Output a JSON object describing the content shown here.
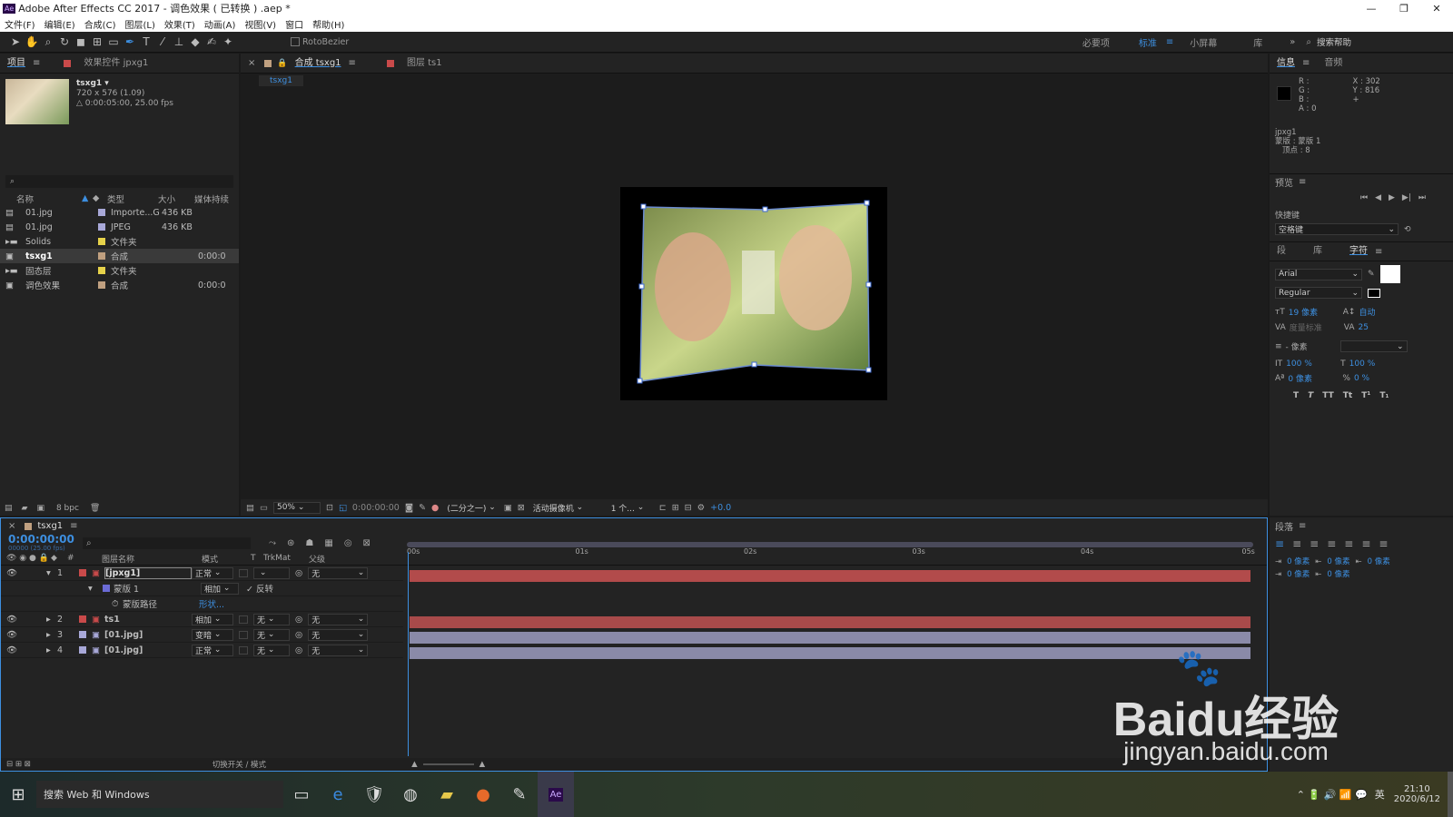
{
  "title_bar": {
    "app_title": "Adobe After Effects CC 2017 - 调色效果 ( 已转换 ) .aep *",
    "logo": "Ae"
  },
  "menu": [
    "文件(F)",
    "编辑(E)",
    "合成(C)",
    "图层(L)",
    "效果(T)",
    "动画(A)",
    "视图(V)",
    "窗口",
    "帮助(H)"
  ],
  "toolbar": {
    "rotobezier": "RotoBezier",
    "workspaces": [
      "必要项",
      "标准",
      "小屏幕",
      "库"
    ],
    "search_placeholder": "搜索帮助"
  },
  "project_panel": {
    "tabs": [
      "项目",
      "效果控件 jpxg1"
    ],
    "item_name": "tsxg1 ▾",
    "item_dims": "720 x 576 (1.09)",
    "item_duration": "△ 0:00:05:00, 25.00 fps",
    "columns": [
      "名称",
      "类型",
      "大小",
      "媒体持续"
    ],
    "items": [
      {
        "name": "01.jpg",
        "type": "Importe...G",
        "size": "436 KB",
        "dur": "",
        "color": "#a8a8d8",
        "kind": "file"
      },
      {
        "name": "01.jpg",
        "type": "JPEG",
        "size": "436 KB",
        "dur": "",
        "color": "#a8a8d8",
        "kind": "file"
      },
      {
        "name": "Solids",
        "type": "文件夹",
        "size": "",
        "dur": "",
        "color": "#e6d24a",
        "kind": "folder"
      },
      {
        "name": "tsxg1",
        "type": "合成",
        "size": "",
        "dur": "0:00:0",
        "color": "#c0a080",
        "kind": "comp",
        "selected": true
      },
      {
        "name": "固态层",
        "type": "文件夹",
        "size": "",
        "dur": "",
        "color": "#e6d24a",
        "kind": "folder"
      },
      {
        "name": "调色效果",
        "type": "合成",
        "size": "",
        "dur": "0:00:0",
        "color": "#c0a080",
        "kind": "comp"
      }
    ],
    "bpc": "8 bpc"
  },
  "comp_panel": {
    "tabs": [
      "合成 tsxg1",
      "图层 ts1"
    ],
    "breadcrumb": "tsxg1",
    "zoom": "50%",
    "timecode": "0:00:00:00",
    "resolution": "(二分之一)",
    "camera": "活动摄像机",
    "views": "1 个...",
    "exposure": "+0.0"
  },
  "info_panel": {
    "tabs": [
      "信息",
      "音频"
    ],
    "rgba": [
      "R :",
      "G :",
      "B :",
      "A : 0"
    ],
    "xy": [
      "X : 302",
      "Y : 816"
    ],
    "layer_info": [
      "jpxg1",
      "蒙版 : 蒙版 1",
      "顶点 : 8"
    ]
  },
  "preview_panel": {
    "title": "预览",
    "shortcut_label": "快捷键",
    "shortcut_value": "空格键"
  },
  "character_panel": {
    "tabs": [
      "段",
      "库",
      "字符"
    ],
    "font": "Arial",
    "style": "Regular",
    "size": "19 像素",
    "leading": "自动",
    "kerning": "度量标准",
    "tracking": "25",
    "stroke": "- 像素",
    "vscale": "100 %",
    "hscale": "100 %",
    "baseline": "0 像素",
    "tsume": "0 %",
    "styles": [
      "T",
      "T",
      "TT",
      "Tt",
      "T¹",
      "T₁"
    ]
  },
  "paragraph_panel": {
    "title": "段落",
    "indents": [
      "0 像素",
      "0 像素",
      "0 像素",
      "0 像素",
      "0 像素"
    ]
  },
  "timeline": {
    "tab": "tsxg1",
    "timecode": "0:00:00:00",
    "frames": "00000 (25.00 fps)",
    "columns": [
      "图层名称",
      "模式",
      "T",
      "TrkMat",
      "父级"
    ],
    "ruler": [
      "00s",
      "01s",
      "02s",
      "03s",
      "04s",
      "05s"
    ],
    "layers": [
      {
        "num": "1",
        "name": "[jpxg1]",
        "mode": "正常",
        "trk": "",
        "parent": "无",
        "color": "#c94a4a",
        "bar": "#b24b4b",
        "expanded": true
      },
      {
        "num": "",
        "name": "蒙版 1",
        "mode": "相加",
        "trk": "✓ 反转",
        "parent": "",
        "color": "#6b6bd6",
        "bar": "",
        "sub": true
      },
      {
        "num": "",
        "name": "蒙版路径",
        "mode": "形状...",
        "trk": "",
        "parent": "",
        "color": "",
        "bar": "",
        "sub2": true
      },
      {
        "num": "2",
        "name": "ts1",
        "mode": "相加",
        "trk": "无",
        "parent": "无",
        "color": "#c94a4a",
        "bar": "#a84a4a"
      },
      {
        "num": "3",
        "name": "[01.jpg]",
        "mode": "变暗",
        "trk": "无",
        "parent": "无",
        "color": "#a8a8d8",
        "bar": "#8a8aa8"
      },
      {
        "num": "4",
        "name": "[01.jpg]",
        "mode": "正常",
        "trk": "无",
        "parent": "无",
        "color": "#a8a8d8",
        "bar": "#8a8aa8"
      }
    ],
    "footer": "切换开关 / 模式"
  },
  "taskbar": {
    "search": "搜索 Web 和 Windows",
    "time": "21:10",
    "date": "2020/6/12",
    "ime": "英"
  },
  "watermark": {
    "brand": "Baidu经验",
    "url": "jingyan.baidu.com"
  },
  "colors": {
    "accent": "#3d8fe0",
    "panel": "#232323",
    "bg": "#1a1a1a"
  }
}
